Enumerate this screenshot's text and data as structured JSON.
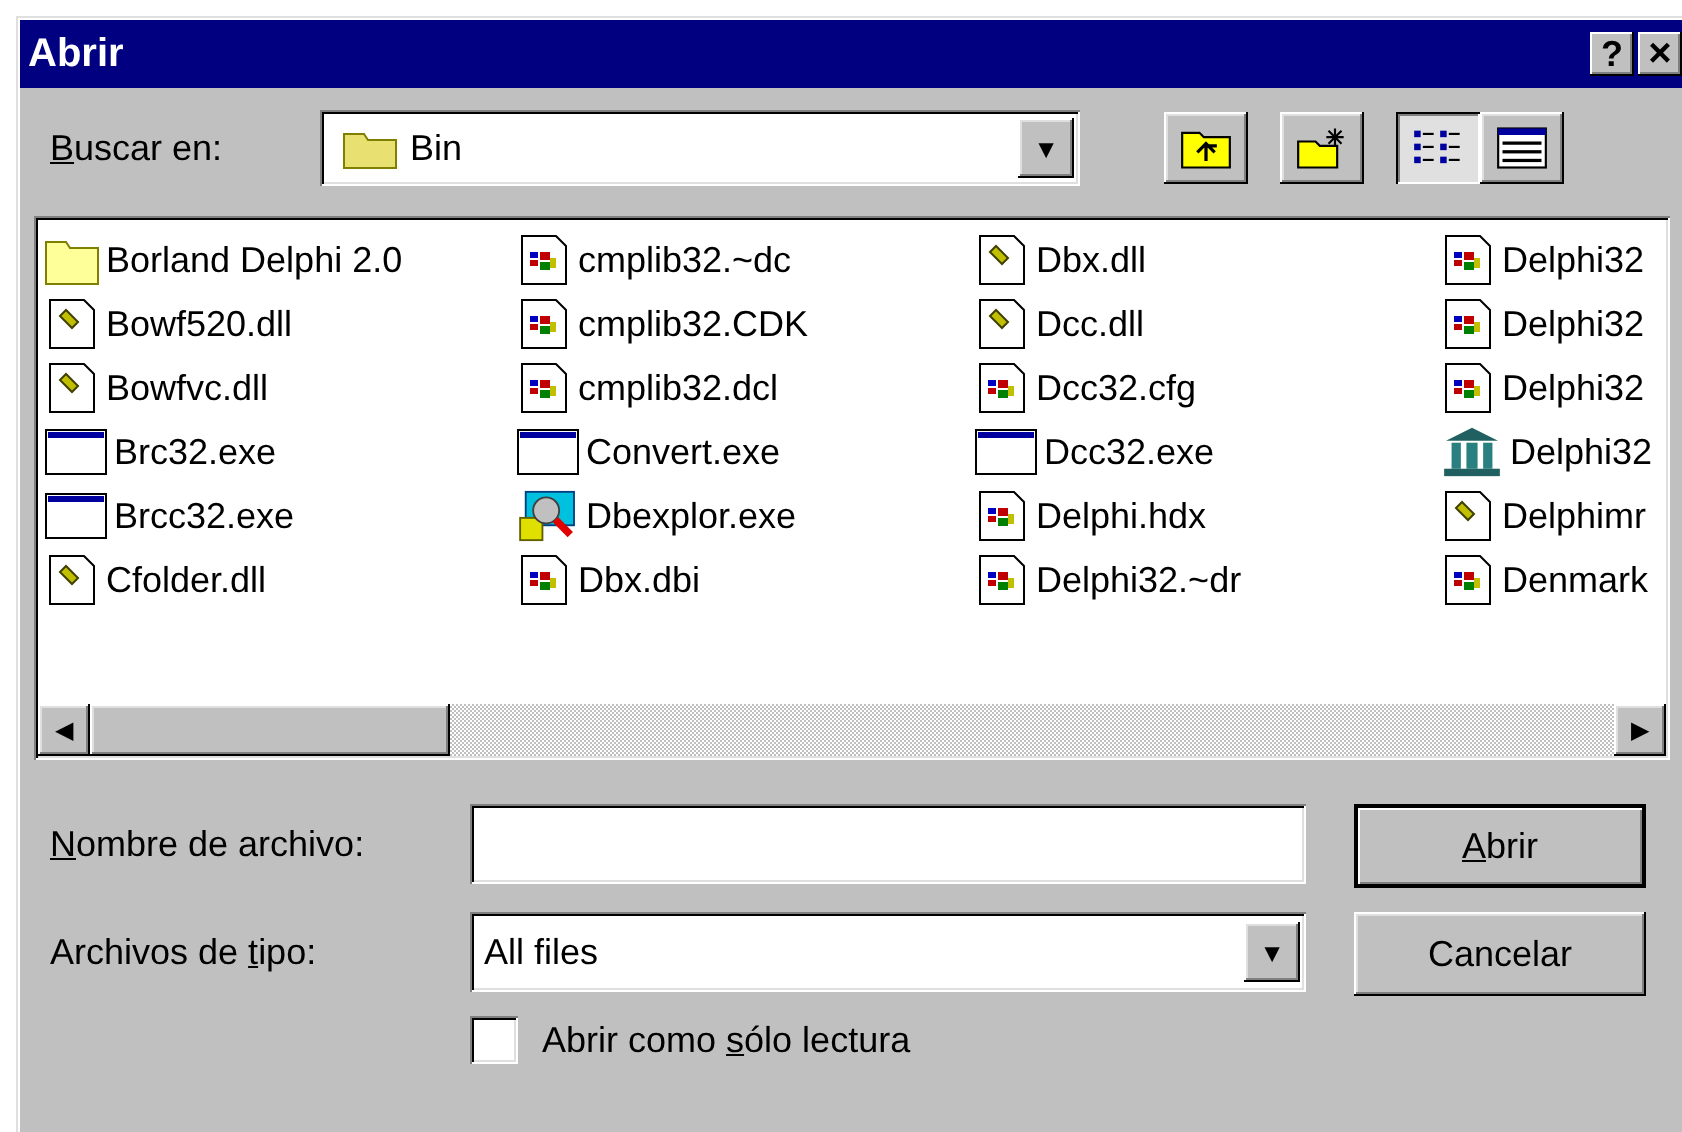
{
  "window": {
    "title": "Abrir",
    "title_buttons": [
      {
        "kind": "help",
        "label": "?"
      },
      {
        "kind": "close",
        "label": "×"
      }
    ]
  },
  "look_in": {
    "label": {
      "key": "B",
      "post": "uscar en:"
    },
    "value": "Bin",
    "dropdown": "▼"
  },
  "toolbar": [
    {
      "kind": "up",
      "selected": false
    },
    {
      "kind": "new",
      "selected": false
    },
    {
      "kind": "list",
      "selected": true
    },
    {
      "kind": "details",
      "selected": false
    }
  ],
  "files": [
    {
      "name": "Borland Delphi 2.0",
      "kind": "folder"
    },
    {
      "name": "Bowf520.dll",
      "kind": "dll"
    },
    {
      "name": "Bowfvc.dll",
      "kind": "dll"
    },
    {
      "name": "Brc32.exe",
      "kind": "exe"
    },
    {
      "name": "Brcc32.exe",
      "kind": "exe"
    },
    {
      "name": "Cfolder.dll",
      "kind": "dll"
    },
    {
      "name": "cmplib32.~dc",
      "kind": "doc"
    },
    {
      "name": "cmplib32.CDK",
      "kind": "doc"
    },
    {
      "name": "cmplib32.dcl",
      "kind": "doc"
    },
    {
      "name": "Convert.exe",
      "kind": "exe"
    },
    {
      "name": "Dbexplor.exe",
      "kind": "explorer"
    },
    {
      "name": "Dbx.dbi",
      "kind": "doc"
    },
    {
      "name": "Dbx.dll",
      "kind": "dll"
    },
    {
      "name": "Dcc.dll",
      "kind": "dll"
    },
    {
      "name": "Dcc32.cfg",
      "kind": "doc"
    },
    {
      "name": "Dcc32.exe",
      "kind": "exe"
    },
    {
      "name": "Delphi.hdx",
      "kind": "doc"
    },
    {
      "name": "Delphi32.~dr",
      "kind": "doc"
    },
    {
      "name": "Delphi32",
      "kind": "doc"
    },
    {
      "name": "Delphi32",
      "kind": "doc"
    },
    {
      "name": "Delphi32",
      "kind": "doc"
    },
    {
      "name": "Delphi32",
      "kind": "library"
    },
    {
      "name": "Delphimr",
      "kind": "dll"
    },
    {
      "name": "Denmark",
      "kind": "doc"
    }
  ],
  "scrollbar": {
    "left": "◀",
    "right": "▶"
  },
  "file_name": {
    "label": {
      "key": "N",
      "post": "ombre de archivo:"
    }
  },
  "file_type": {
    "label": {
      "pre": "Archivos de ",
      "key": "t",
      "post": "ipo:"
    },
    "value": "All files",
    "dropdown": "▼"
  },
  "read_only": {
    "label": {
      "pre": "Abrir como ",
      "key": "s",
      "post": "ólo lectura"
    },
    "checked": false
  },
  "buttons": [
    {
      "label": {
        "key": "A",
        "post": "brir"
      },
      "default": true
    },
    {
      "label": {
        "post": "Cancelar"
      },
      "default": false
    }
  ]
}
